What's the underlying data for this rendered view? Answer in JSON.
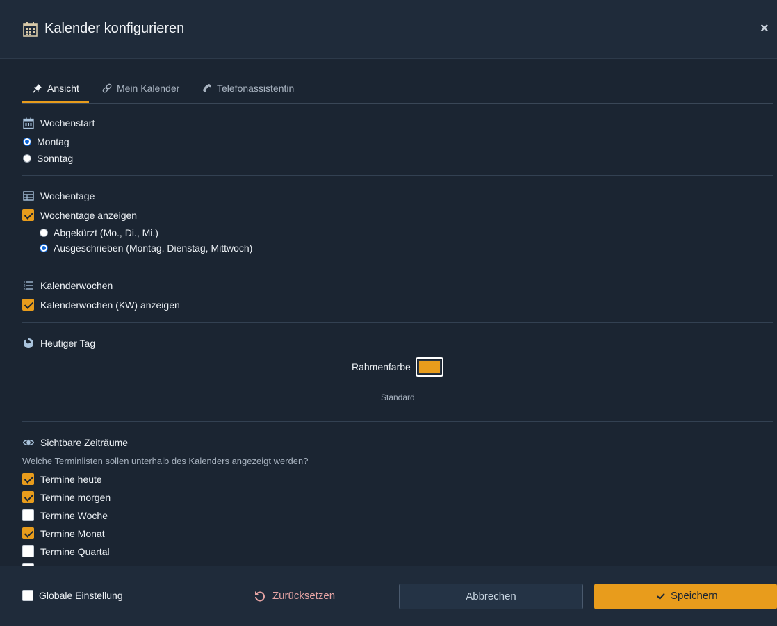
{
  "dialog": {
    "title": "Kalender konfigurieren",
    "close_label": "×"
  },
  "tabs": [
    {
      "label": "Ansicht",
      "icon": "pin-icon",
      "active": true
    },
    {
      "label": "Mein Kalender",
      "icon": "link-icon",
      "active": false
    },
    {
      "label": "Telefonassistentin",
      "icon": "phone-icon",
      "active": false
    }
  ],
  "week_start": {
    "title": "Wochenstart",
    "icon": "calendar-icon",
    "options": [
      {
        "label": "Montag",
        "selected": true
      },
      {
        "label": "Sonntag",
        "selected": false
      }
    ]
  },
  "weekdays": {
    "title": "Wochentage",
    "icon": "table-icon",
    "show_label": "Wochentage anzeigen",
    "show_checked": true,
    "formats": [
      {
        "label": "Abgekürzt (Mo., Di., Mi.)",
        "selected": false
      },
      {
        "label": "Ausgeschrieben (Montag, Dienstag, Mittwoch)",
        "selected": true
      }
    ]
  },
  "calendar_weeks": {
    "title": "Kalenderwochen",
    "icon": "numbered-list-icon",
    "show_label": "Kalenderwochen (KW) anzeigen",
    "show_checked": true
  },
  "today": {
    "title": "Heutiger Tag",
    "icon": "palette-icon",
    "border_color_label": "Rahmenfarbe",
    "border_color": "#e89c1c",
    "default_label": "Standard"
  },
  "visible_periods": {
    "title": "Sichtbare Zeiträume",
    "icon": "eye-icon",
    "hint": "Welche Terminlisten sollen unterhalb des Kalenders angezeigt werden?",
    "items": [
      {
        "label": "Termine heute",
        "checked": true
      },
      {
        "label": "Termine morgen",
        "checked": true
      },
      {
        "label": "Termine Woche",
        "checked": false
      },
      {
        "label": "Termine Monat",
        "checked": true
      },
      {
        "label": "Termine Quartal",
        "checked": false
      }
    ]
  },
  "footer": {
    "global_label": "Globale Einstellung",
    "global_checked": false,
    "reset_label": "Zurücksetzen",
    "cancel_label": "Abbrechen",
    "save_label": "Speichern"
  },
  "colors": {
    "accent": "#e89c1c",
    "background": "#1b2532",
    "header": "#1f2b3a",
    "reset_text": "#e6a4a4"
  }
}
